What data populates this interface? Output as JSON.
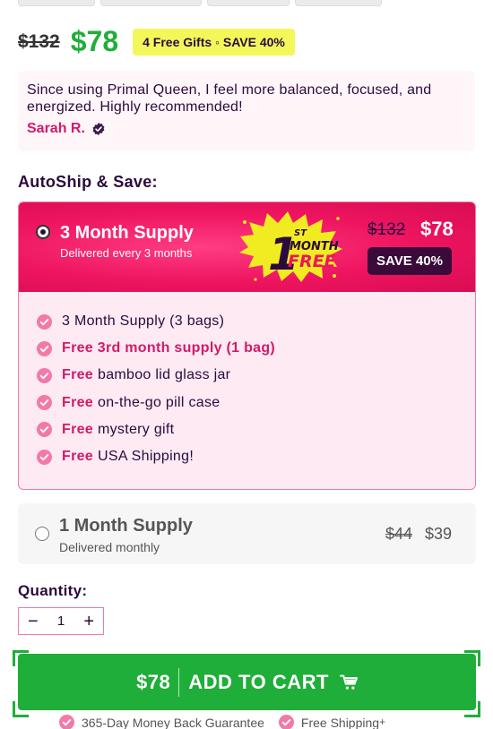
{
  "pricing": {
    "old_price": "$132",
    "new_price": "$78",
    "gift_badge": "4 Free Gifts ◦ SAVE 40%"
  },
  "testimonial": {
    "text": "Since using Primal Queen, I feel more balanced, focused, and energized. Highly recommended!",
    "author": "Sarah R."
  },
  "autoship": {
    "title": "AutoShip & Save:"
  },
  "plan_3_month": {
    "title": "3 Month Supply",
    "subtitle": "Delivered every 3 months",
    "badge": {
      "sup": "ST",
      "number": "1",
      "line1": "MONTH",
      "line2": "FREE"
    },
    "old_price": "$132",
    "new_price": "$78",
    "save": "SAVE 40%",
    "selected": true,
    "benefits": [
      {
        "strong": "",
        "text": "3 Month Supply (3 bags)"
      },
      {
        "strong": "Free 3rd month supply (1 bag)",
        "text": ""
      },
      {
        "strong": "Free",
        "text": "bamboo lid glass jar"
      },
      {
        "strong": "Free",
        "text": "on-the-go pill case"
      },
      {
        "strong": "Free",
        "text": "mystery gift"
      },
      {
        "strong": "Free",
        "text": "USA Shipping!"
      }
    ]
  },
  "plan_1_month": {
    "title": "1 Month Supply",
    "subtitle": "Delivered monthly",
    "old_price": "$44",
    "new_price": "$39",
    "selected": false
  },
  "quantity": {
    "label": "Quantity:",
    "minus": "−",
    "value": "1",
    "plus": "+"
  },
  "cart": {
    "price": "$78",
    "label": "ADD TO CART"
  },
  "guarantees": {
    "money_back": "365-Day Money Back Guarantee",
    "shipping": "Free Shipping",
    "shipping_mark": "+"
  },
  "colors": {
    "brand_green": "#1fae3a",
    "brand_pink": "#ee1460",
    "accent_magenta": "#d11b6a",
    "dark_purple": "#2b0a3d",
    "gift_yellow": "#f4f75a"
  },
  "icons": {
    "verified": "verified-badge-icon",
    "check": "check-circle-icon",
    "cart": "shopping-cart-icon"
  }
}
